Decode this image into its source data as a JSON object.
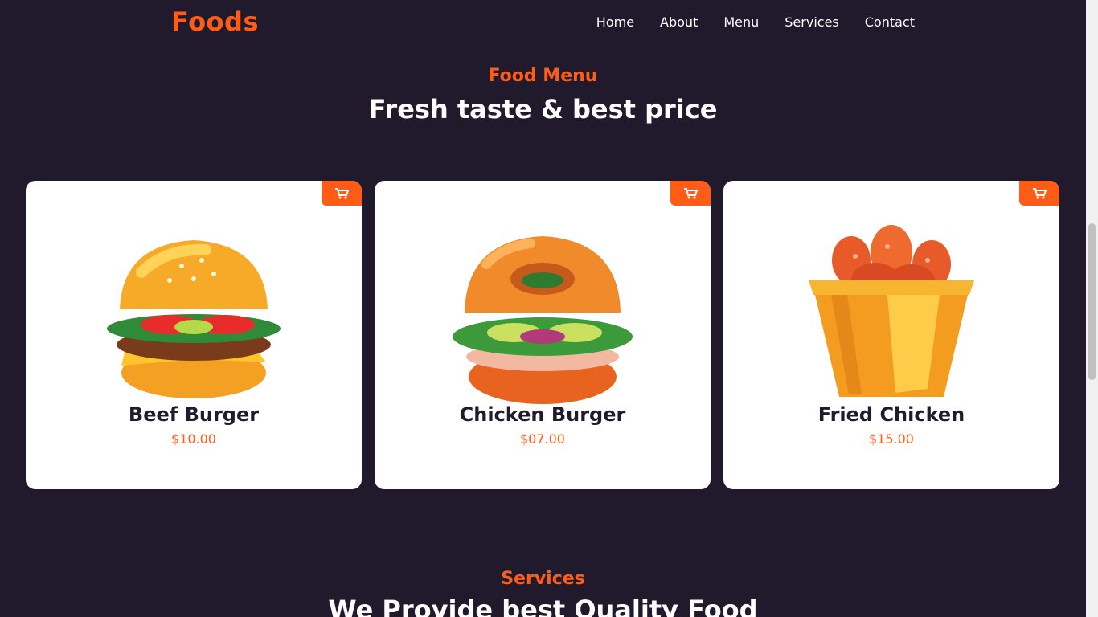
{
  "brand": {
    "name": "Foods",
    "accent": "#ff5d17"
  },
  "nav": {
    "items": [
      {
        "label": "Home"
      },
      {
        "label": "About"
      },
      {
        "label": "Menu"
      },
      {
        "label": "Services"
      },
      {
        "label": "Contact"
      }
    ]
  },
  "menu_section": {
    "subtitle": "Food Menu",
    "title": "Fresh taste & best price",
    "items": [
      {
        "name": "Beef Burger",
        "price": "$10.00",
        "icon": "beef-burger-icon"
      },
      {
        "name": "Chicken Burger",
        "price": "$07.00",
        "icon": "chicken-burger-icon"
      },
      {
        "name": "Fried Chicken",
        "price": "$15.00",
        "icon": "fried-chicken-icon"
      }
    ],
    "cart_icon": "add-to-cart-icon"
  },
  "services_section": {
    "subtitle": "Services",
    "title": "We Provide best Quality Food"
  },
  "colors": {
    "background": "#211a2c",
    "card": "#ffffff",
    "accent": "#ff5d17",
    "text_dark": "#211a2c"
  }
}
